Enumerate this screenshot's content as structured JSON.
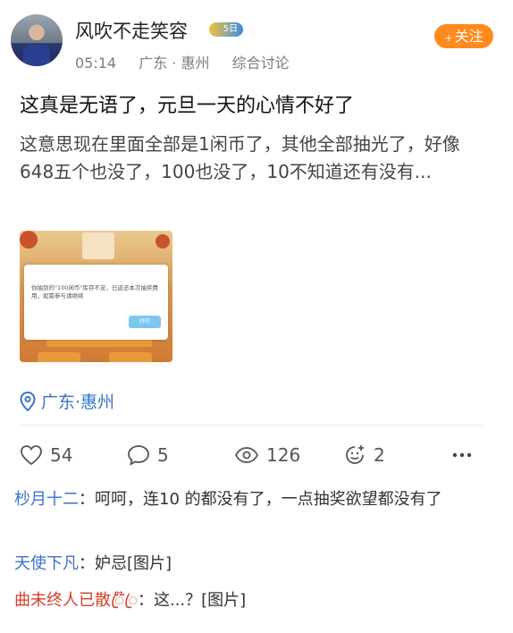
{
  "author": {
    "name": "风吹不走笑容",
    "time": "05:14",
    "location": "广东 · 惠州",
    "section": "综合讨论",
    "badge_text": "5日"
  },
  "follow_label": "关注",
  "post": {
    "title": "这真是无语了，元旦一天的心情不好了",
    "content": "这意思现在里面全部是1闲币了，其他全部抽光了，好像648五个也没了，100也没了，10不知道还有没有...",
    "image": {
      "dialog_message": "你抽到的\"100闲币\"库存不足，已返还本次抽奖费用，如需参与请继续",
      "dialog_button": "好的",
      "icon": "image-thumbnail"
    },
    "location_tag": "广东·惠州"
  },
  "stats": {
    "likes": "54",
    "comments": "5",
    "views": "126",
    "reactions": "2"
  },
  "icons": {
    "like": "heart-icon",
    "comment": "comment-bubble-icon",
    "views": "eye-icon",
    "reaction": "smiley-icon",
    "more": "more-dots-icon",
    "location": "location-pin-icon"
  },
  "comments": [
    {
      "name": "杪月十二",
      "text": "呵呵，连10 的都没有了，一点抽奖欲望都没有了"
    },
    {
      "name": "天使下凡",
      "text": "妒忌[图片]"
    },
    {
      "name": "曲未终人已散ꦿ໊ꦿ",
      "text": "这...？[图片]"
    }
  ],
  "colors": {
    "accent_orange": "#ff8a1e",
    "link_blue": "#3a73c9",
    "name_red": "#d2402a"
  }
}
